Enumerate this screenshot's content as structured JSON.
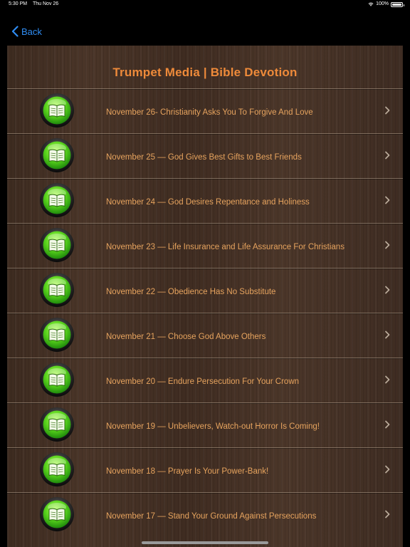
{
  "status_bar": {
    "time": "5:30 PM",
    "date": "Thu Nov 26",
    "battery": "100%"
  },
  "nav": {
    "back_label": "Back",
    "accent_color": "#2f8cf2"
  },
  "header": {
    "title": "Trumpet Media | Bible Devotion",
    "title_color": "#ee8a3a"
  },
  "list": {
    "item_icon": "bible-icon",
    "items": [
      {
        "label": "November 26- Christianity Asks You To Forgive And Love"
      },
      {
        "label": "November 25 — God Gives Best Gifts to Best Friends"
      },
      {
        "label": "November 24 — God Desires Repentance and Holiness"
      },
      {
        "label": "November 23 — Life Insurance and Life Assurance For Christians"
      },
      {
        "label": "November 22 — Obedience Has No Substitute"
      },
      {
        "label": "November 21 — Choose God Above Others"
      },
      {
        "label": "November 20 — Endure Persecution For Your Crown"
      },
      {
        "label": "November 19 — Unbelievers, Watch-out Horror Is Coming!"
      },
      {
        "label": "November 18 — Prayer Is Your Power-Bank!"
      },
      {
        "label": "November 17 — Stand Your Ground Against Persecutions"
      }
    ]
  }
}
